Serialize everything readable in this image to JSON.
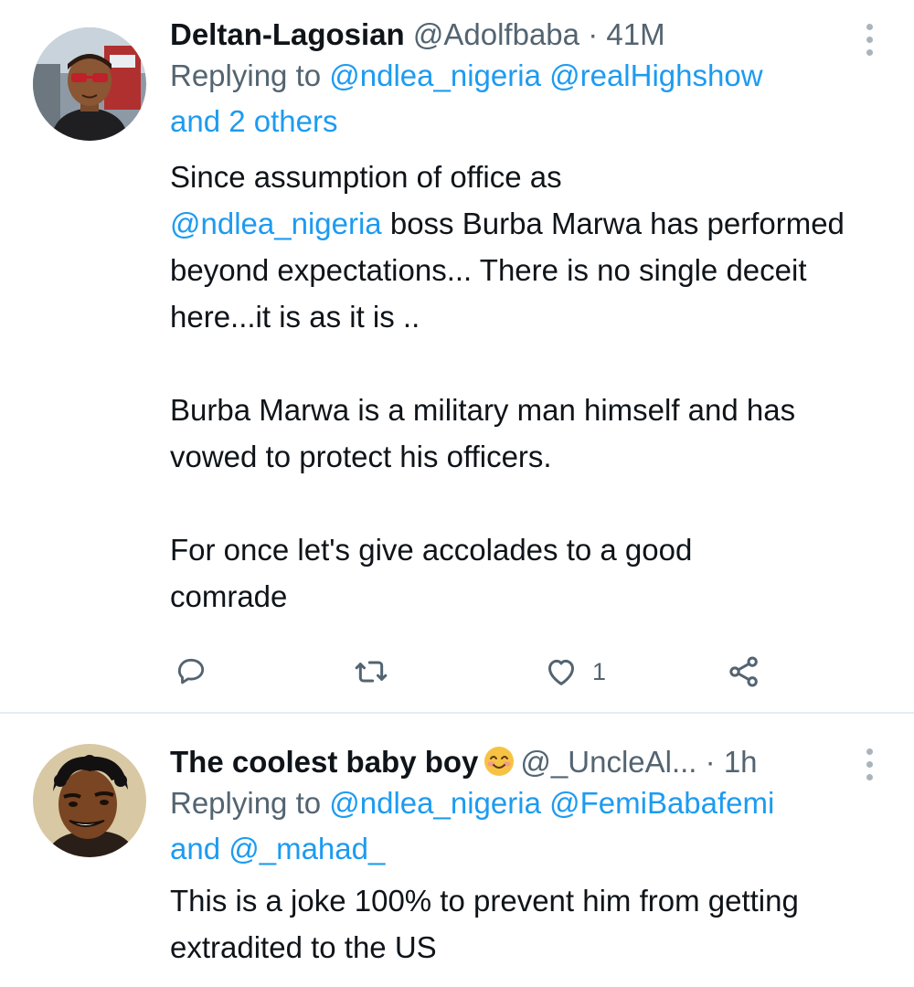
{
  "tweets": [
    {
      "display_name": "Deltan-Lagosian",
      "handle": "@Adolfbaba",
      "separator": "·",
      "time": "41M",
      "replying_prefix": "Replying to ",
      "reply_to_1": "@ndlea_nigeria",
      "reply_to_2": "@realHighshow",
      "reply_suffix": "and 2 others",
      "p1_mention": "@ndlea_nigeria",
      "p1_a": "Since assumption of office as",
      "p1_b": " boss Burba Marwa has performed beyond expectations... There is no single deceit here...it is as it is ..",
      "p2": "Burba Marwa is a military man himself and has vowed to protect his officers.",
      "p3": "For once let's give accolades to a good comrade",
      "like_count": "1"
    },
    {
      "display_name": "The coolest baby boy",
      "handle": "@_UncleAl...",
      "separator": "·",
      "time": "1h",
      "replying_prefix": "Replying to ",
      "reply_to_1": "@ndlea_nigeria",
      "reply_to_2": "@FemiBabafemi",
      "reply_and": "and ",
      "reply_to_3": "@_mahad_",
      "text": "This is a joke 100% to prevent him from getting extradited to the US"
    }
  ],
  "icons": {
    "reply": "speech-bubble-icon",
    "retweet": "retweet-icon",
    "like": "heart-icon",
    "share": "share-icon",
    "more": "vertical-ellipsis-icon",
    "emoji": "smiling-face-emoji"
  },
  "colors": {
    "link": "#1d9bf0",
    "muted": "#536471",
    "text": "#0f1419",
    "divider": "#e6ecf0"
  }
}
